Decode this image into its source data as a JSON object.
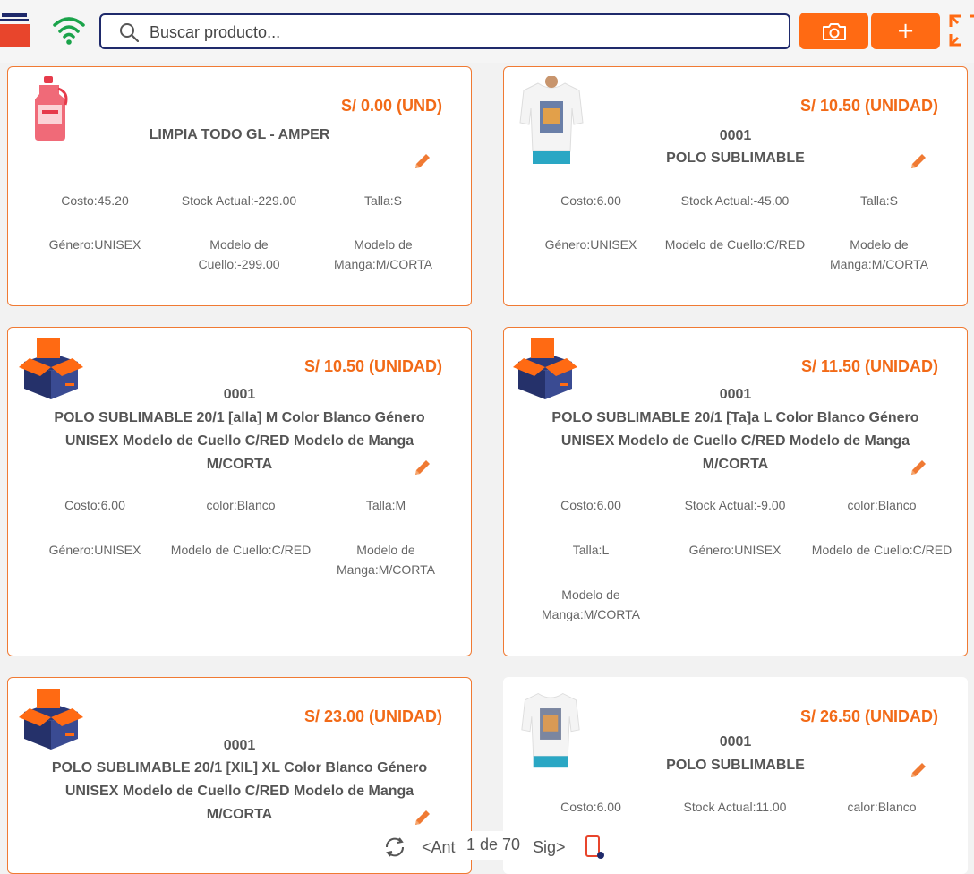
{
  "search": {
    "placeholder": "Buscar producto..."
  },
  "toolbar": {
    "add_label": "+"
  },
  "pager": {
    "prev_label": "<Ant",
    "page_info": "1 de 70",
    "next_label": "Sig>"
  },
  "colors": {
    "accent": "#ff6a13",
    "price": "#f26a17",
    "search_border": "#1f2a6b",
    "wifi": "#1aa34a"
  },
  "cards": [
    {
      "price": "S/ 0.00 (UND)",
      "code": "",
      "name": "LIMPIA TODO GL - AMPER",
      "attrs": [
        {
          "label": "Costo:",
          "value": "45.20"
        },
        {
          "label": "Stock Actual:",
          "value": "-229.00"
        },
        {
          "label": "Talla:",
          "value": "S"
        },
        {
          "label": "Género:",
          "value": "UNISEX"
        },
        {
          "label": "Modelo de Cuello:",
          "value": "-299.00"
        },
        {
          "label": "Modelo de Manga:",
          "value": "M/CORTA"
        }
      ]
    },
    {
      "price": "S/ 10.50 (UNIDAD)",
      "code": "0001",
      "name": "POLO SUBLIMABLE",
      "attrs": [
        {
          "label": "Costo:",
          "value": "6.00"
        },
        {
          "label": "Stock Actual:",
          "value": "-45.00"
        },
        {
          "label": "Talla:",
          "value": "S"
        },
        {
          "label": "Género:",
          "value": "UNISEX"
        },
        {
          "label": "Modelo de Cuello:",
          "value": "C/RED"
        },
        {
          "label": "Modelo de Manga:",
          "value": "M/CORTA"
        }
      ]
    },
    {
      "price": "S/ 10.50 (UNIDAD)",
      "code": "0001",
      "name": "POLO SUBLIMABLE 20/1 [alla] M Color Blanco Género UNISEX Modelo de Cuello C/RED Modelo de Manga M/CORTA",
      "attrs": [
        {
          "label": "Costo:",
          "value": "6.00"
        },
        {
          "label": "color:",
          "value": "Blanco"
        },
        {
          "label": "Talla:",
          "value": "M"
        },
        {
          "label": "Género:",
          "value": "UNISEX"
        },
        {
          "label": "Modelo de Cuello:",
          "value": "C/RED"
        },
        {
          "label": "Modelo de Manga:",
          "value": "M/CORTA"
        }
      ]
    },
    {
      "price": "S/ 11.50 (UNIDAD)",
      "code": "0001",
      "name": "POLO SUBLIMABLE 20/1 [Ta]a L Color Blanco Género UNISEX Modelo de Cuello C/RED Modelo de Manga M/CORTA",
      "attrs": [
        {
          "label": "Costo:",
          "value": "6.00"
        },
        {
          "label": "Stock Actual:",
          "value": "-9.00"
        },
        {
          "label": "color:",
          "value": "Blanco"
        },
        {
          "label": "Talla:",
          "value": "L"
        },
        {
          "label": "Género:",
          "value": "UNISEX"
        },
        {
          "label": "Modelo de Cuello:",
          "value": "C/RED"
        },
        {
          "label": "Modelo de Manga:",
          "value": "M/CORTA"
        }
      ]
    },
    {
      "price": "S/ 23.00 (UNIDAD)",
      "code": "0001",
      "name": "POLO SUBLIMABLE 20/1 [XIL] XL Color Blanco Género UNISEX Modelo de Cuello C/RED Modelo de Manga M/CORTA",
      "attrs": []
    },
    {
      "price": "S/ 26.50 (UNIDAD)",
      "code": "0001",
      "name": "POLO SUBLIMABLE",
      "attrs": [
        {
          "label": "Costo:",
          "value": "6.00"
        },
        {
          "label": "Stock Actual:",
          "value": "11.00"
        },
        {
          "label": "calor:",
          "value": "Blanco"
        }
      ]
    }
  ]
}
